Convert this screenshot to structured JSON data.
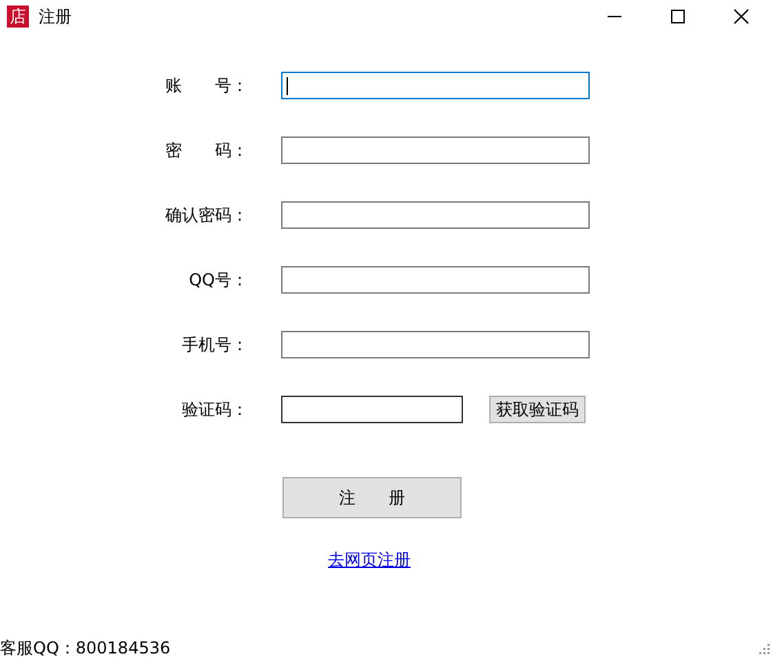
{
  "window": {
    "icon_text": "店",
    "title": "注册"
  },
  "fields": [
    {
      "kind": "text",
      "label": "账　　号：",
      "focused": true
    },
    {
      "kind": "text",
      "label": "密　　码：",
      "focused": false
    },
    {
      "kind": "text",
      "label": "确认密码：",
      "focused": false
    },
    {
      "kind": "text",
      "label": "QQ号：",
      "focused": false
    },
    {
      "kind": "text",
      "label": "手机号：",
      "focused": false
    },
    {
      "kind": "code",
      "label": "验证码：",
      "focused": false,
      "button": "获取验证码"
    }
  ],
  "submit": "注　　册",
  "web_link": "去网页注册",
  "footer": "客服QQ：800184536"
}
